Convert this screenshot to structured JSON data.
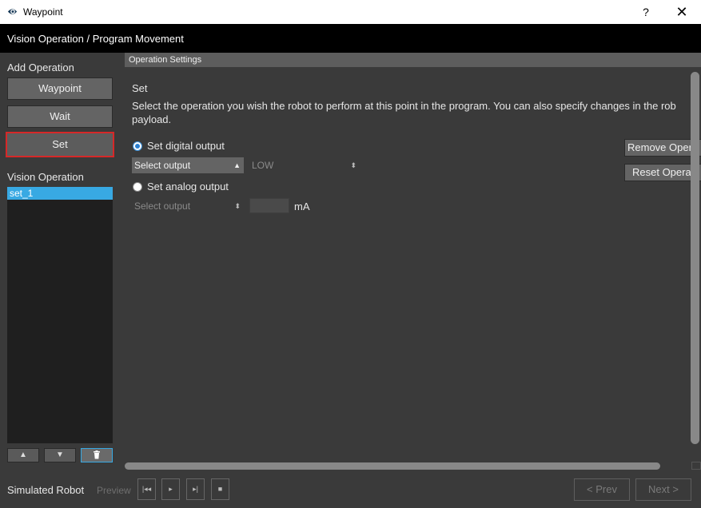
{
  "window": {
    "title": "Waypoint",
    "help_label": "?",
    "close_label": "✕"
  },
  "header": {
    "breadcrumb": "Vision Operation / Program Movement"
  },
  "left_panel": {
    "add_operation_label": "Add Operation",
    "buttons": [
      {
        "label": "Waypoint"
      },
      {
        "label": "Wait"
      },
      {
        "label": "Set",
        "selected": true
      }
    ],
    "vision_operation_label": "Vision Operation",
    "list_items": [
      {
        "label": "set_1",
        "selected": true
      }
    ],
    "list_controls": {
      "up_icon": "▲",
      "down_icon": "▼",
      "delete_icon": "🗑"
    }
  },
  "settings": {
    "header_label": "Operation Settings",
    "title": "Set",
    "description_line1": "Select the operation you wish the robot to perform at this point in the program. You can also specify changes in the rob",
    "description_line2": "payload.",
    "digital": {
      "radio_label": "Set digital output",
      "checked": true,
      "output_select": "Select output",
      "level_select": "LOW"
    },
    "analog": {
      "radio_label": "Set analog output",
      "checked": false,
      "output_select": "Select output",
      "value": "",
      "unit": "mA"
    },
    "remove_button": "Remove Oper",
    "reset_button": "Reset Operat"
  },
  "bottom_bar": {
    "robot_label": "Simulated Robot",
    "preview_label": "Preview",
    "controls": [
      "|◂◂",
      "▸",
      "▸|",
      "■"
    ],
    "prev_label": "< Prev",
    "next_label": "Next >"
  },
  "colors": {
    "accent": "#38a9e3",
    "selected_border": "#d62828",
    "background": "#3a3a3a",
    "header_bg": "#000000"
  }
}
